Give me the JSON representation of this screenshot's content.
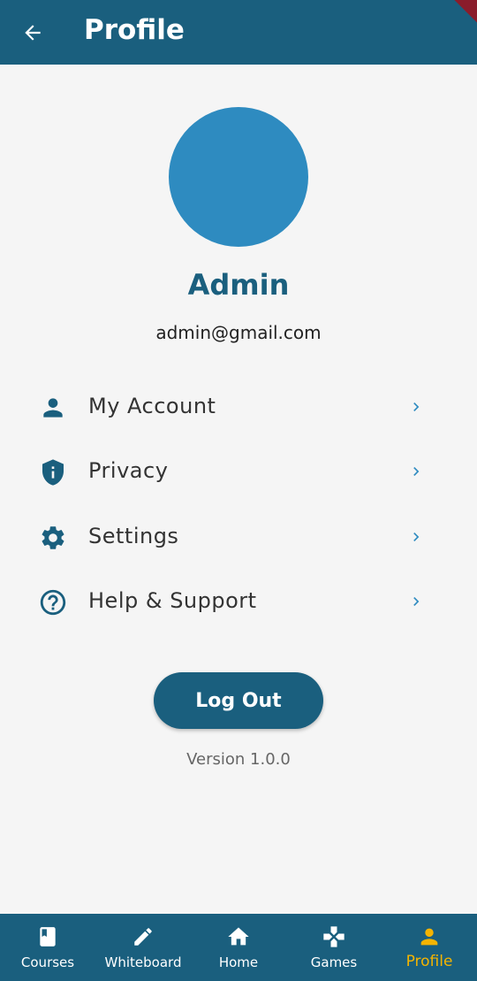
{
  "appbar": {
    "title": "Profile"
  },
  "profile": {
    "name": "Admin",
    "email": "admin@gmail.com",
    "avatar_color": "#2e8bc0"
  },
  "menu": [
    {
      "label": "My Account",
      "icon": "person-icon"
    },
    {
      "label": "Privacy",
      "icon": "shield-info-icon"
    },
    {
      "label": "Settings",
      "icon": "gear-icon"
    },
    {
      "label": "Help & Support",
      "icon": "help-circle-icon"
    }
  ],
  "logout": {
    "label": "Log Out"
  },
  "version": "Version 1.0.0",
  "bottom_nav": {
    "items": [
      {
        "label": "Courses",
        "icon": "book-icon"
      },
      {
        "label": "Whiteboard",
        "icon": "pencil-icon"
      },
      {
        "label": "Home",
        "icon": "home-icon"
      },
      {
        "label": "Games",
        "icon": "gamepad-icon"
      },
      {
        "label": "Profile",
        "icon": "person-icon",
        "active": true
      }
    ]
  },
  "colors": {
    "primary": "#1a5f7e",
    "accent": "#2e8bc0",
    "active_nav": "#f5b400",
    "background": "#f5f5f5"
  }
}
